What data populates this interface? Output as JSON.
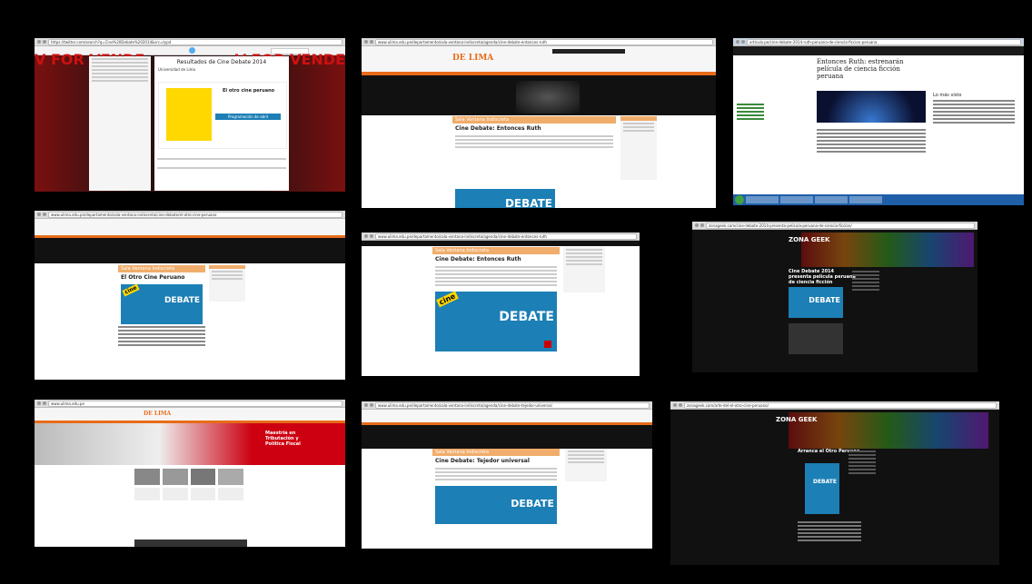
{
  "frames": {
    "f1": {
      "url": "https://twitter.com/search?q=Cine%20Debate%202014&src=typd",
      "title": "Resultados de Cine Debate 2014",
      "poster_title": "El otro cine peruano",
      "poster_sub": "Programación de abril",
      "tweet_user": "Universidad de Lima",
      "banner_text": "V FOR VENDE"
    },
    "f2": {
      "url": "www.ulima.edu.pe/departamento/sala-ventana-indiscreta/agenda/cine-debate-entonces-ruth",
      "logo": "DE LIMA",
      "bar": "Sala Ventana Indiscreta",
      "post_title": "Cine Debate: Entonces Ruth",
      "poster_word": "DEBATE"
    },
    "f3": {
      "url": "articulo.pe/cine-debate-2014-ruth-peruana-de-ciencia-ficcion-peruana",
      "article_title": "Entonces Ruth: estrenarán película de ciencia ficción peruana",
      "side_title": "Lo más visto"
    },
    "f4": {
      "url": "www.ulima.edu.pe/departamento/sala-ventana-indiscreta/cine-debate/el-otro-cine-peruano",
      "bar": "Sala Ventana Indiscreta",
      "post_title": "El Otro Cine Peruano",
      "poster_word": "DEBATE"
    },
    "f5": {
      "url": "www.ulima.edu.pe/departamento/sala-ventana-indiscreta/agenda/cine-debate-entonces-ruth",
      "bar": "Sala Ventana Indiscreta",
      "post_title": "Cine Debate: Entonces Ruth",
      "poster_word": "DEBATE",
      "poster_tag": "cine"
    },
    "f6": {
      "url": "zonageek.com/cine-debate-2014-presenta-pelicula-peruana-de-ciencia-ficcion/",
      "logo": "ZONA GEEK",
      "post_title": "Cine Debate 2014 presenta película peruana de ciencia ficción",
      "poster_word": "DEBATE"
    },
    "f7": {
      "url": "www.ulima.edu.pe",
      "logo": "DE LIMA",
      "hero": "Maestría en Tributación y Política Fiscal"
    },
    "f8": {
      "url": "www.ulima.edu.pe/departamento/sala-ventana-indiscreta/agenda/cine-debate-tejedor-universal",
      "bar": "Sala Ventana Indiscreta",
      "post_title": "Cine Debate: Tejedor universal",
      "poster_word": "DEBATE"
    },
    "f9": {
      "url": "zonageek.com/arte-del-el-otro-cine-peruano/",
      "logo": "ZONA GEEK",
      "post_title": "Arranca el Otro Peruano",
      "poster_word": "DEBATE"
    }
  },
  "colors": {
    "background": "#000000",
    "ulima_orange": "#e86c1a",
    "poster_blue": "#1c7fb5",
    "poster_yellow": "#ffd800"
  }
}
